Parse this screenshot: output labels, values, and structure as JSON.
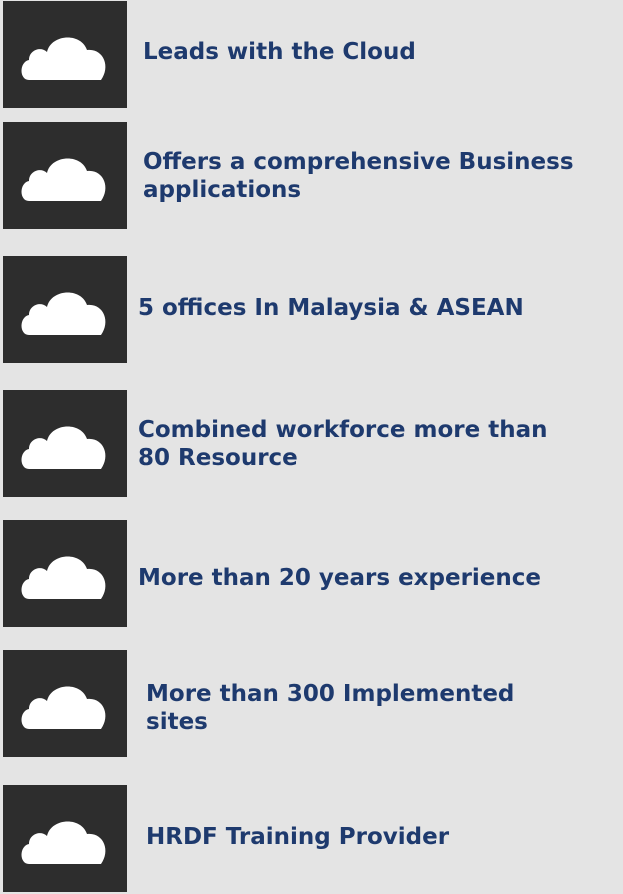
{
  "items": [
    {
      "icon": "cloud-icon",
      "label_lines": [
        "Leads with the Cloud"
      ]
    },
    {
      "icon": "cloud-icon",
      "label_lines": [
        "Offers a comprehensive Business",
        "applications"
      ]
    },
    {
      "icon": "cloud-icon",
      "label_lines": [
        "5 offices In Malaysia & ASEAN"
      ]
    },
    {
      "icon": "cloud-icon",
      "label_lines": [
        "Combined workforce more than",
        "80 Resource"
      ]
    },
    {
      "icon": "cloud-icon",
      "label_lines": [
        "More than 20 years experience"
      ]
    },
    {
      "icon": "cloud-icon",
      "label_lines": [
        "More than 300 Implemented",
        "sites"
      ]
    },
    {
      "icon": "cloud-icon",
      "label_lines": [
        "HRDF Training Provider"
      ]
    }
  ],
  "colors": {
    "background": "#e4e4e4",
    "tile": "#2d2d2d",
    "icon": "#ffffff",
    "text": "#1e3a6e"
  }
}
